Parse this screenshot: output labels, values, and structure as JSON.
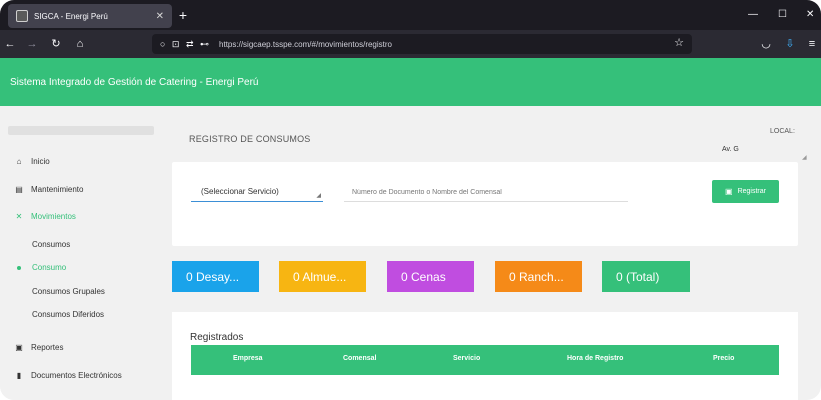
{
  "browser": {
    "tab_title": "SIGCA - Energi Perú",
    "tab_close": "✕",
    "new_tab": "+",
    "url": "https://sigcaep.tsspe.com/#/movimientos/registro",
    "nav_icons": [
      "back-icon",
      "forward-icon",
      "reload-icon",
      "home-icon"
    ],
    "window_controls": [
      "—",
      "☐",
      "✕"
    ]
  },
  "header": {
    "title": "Sistema Integrado de Gestión de Catering - Energi Perú",
    "color": "#35c07a"
  },
  "sidebar": {
    "items": [
      {
        "label": "Inicio",
        "icon": "home-icon",
        "glyph": "⌂"
      },
      {
        "label": "Mantenimiento",
        "icon": "database-icon",
        "glyph": "▤"
      },
      {
        "label": "Movimientos",
        "icon": "utensils-icon",
        "glyph": "✕"
      },
      {
        "label": "Reportes",
        "icon": "report-icon",
        "glyph": "▣"
      },
      {
        "label": "Documentos Electrónicos",
        "icon": "document-icon",
        "glyph": "▮"
      }
    ],
    "sub_items": [
      {
        "label": "Consumos"
      },
      {
        "label": "Consumo"
      },
      {
        "label": "Consumos Grupales"
      },
      {
        "label": "Consumos Diferidos"
      }
    ]
  },
  "main": {
    "page_title": "REGISTRO DE CONSUMOS",
    "local_label": "LOCAL:",
    "local_value": "Av. G",
    "service_select": "(Seleccionar Servicio)",
    "doc_placeholder": "Número de Documento o Nombre del Comensal",
    "register_button": "Registrar",
    "counters": [
      {
        "label": "0 Desay...",
        "color": "#1aa3ea"
      },
      {
        "label": "0 Almue...",
        "color": "#f7b512"
      },
      {
        "label": "0 Cenas",
        "color": "#c04de0"
      },
      {
        "label": "0 Ranch...",
        "color": "#f58a18"
      },
      {
        "label": "0 (Total)",
        "color": "#35c07a"
      }
    ],
    "table": {
      "title": "Registrados",
      "columns": [
        "Empresa",
        "Comensal",
        "Servicio",
        "Hora de Registro",
        "Precio"
      ]
    }
  }
}
